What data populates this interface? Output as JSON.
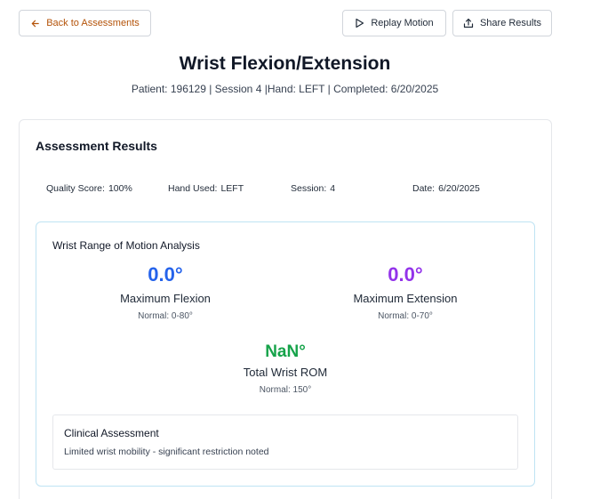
{
  "header": {
    "back_label": "Back to Assessments",
    "replay_label": "Replay Motion",
    "share_label": "Share Results",
    "title": "Wrist Flexion/Extension",
    "subtitle": "Patient: 196129 | Session 4 |Hand: LEFT | Completed: 6/20/2025"
  },
  "results": {
    "title": "Assessment Results",
    "meta": {
      "quality_label": "Quality Score:",
      "quality_value": "100%",
      "hand_label": "Hand Used:",
      "hand_value": "LEFT",
      "session_label": "Session:",
      "session_value": "4",
      "date_label": "Date:",
      "date_value": "6/20/2025"
    },
    "rom": {
      "title": "Wrist Range of Motion Analysis",
      "flexion": {
        "value": "0.0°",
        "label": "Maximum Flexion",
        "normal": "Normal: 0-80°"
      },
      "extension": {
        "value": "0.0°",
        "label": "Maximum Extension",
        "normal": "Normal: 0-70°"
      },
      "total": {
        "value": "NaN°",
        "label": "Total Wrist ROM",
        "normal": "Normal: 150°"
      }
    },
    "clinical": {
      "title": "Clinical Assessment",
      "text": "Limited wrist mobility - significant restriction noted"
    }
  },
  "icons": {
    "back": "arrow-left-icon",
    "replay": "play-icon",
    "share": "share-icon"
  },
  "colors": {
    "flexion": "#2563eb",
    "extension": "#9333ea",
    "total": "#16a34a",
    "back_link": "#b45309"
  }
}
